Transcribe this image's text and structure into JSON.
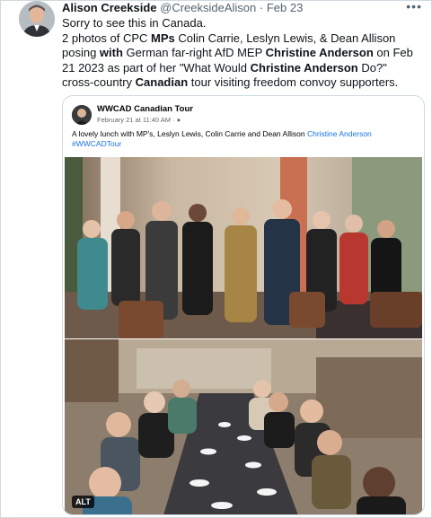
{
  "author": {
    "name": "Alison Creekside",
    "handle": "@CreeksideAlison",
    "separator": "·",
    "time": "Feb 23",
    "more_icon": "more-horizontal-icon"
  },
  "tweet": {
    "line1": "Sorry to see this in Canada.",
    "p1": "2 photos of CPC ",
    "b1": "MPs",
    "p2": " Colin Carrie, Leslyn Lewis, & Dean Allison posing ",
    "b2": "with",
    "p3": " German far-right AfD MEP ",
    "b3": "Christine Anderson",
    "p4": " on Feb 21 2023 as part of her \"What Would ",
    "b4": "Christine Anderson",
    "p5": " Do?\" cross-country ",
    "b5": "Canadian",
    "p6": " tour visiting freedom convoy supporters."
  },
  "card": {
    "page_name": "WWCAD Canadian Tour",
    "meta": "February 21 at 11:40 AM · ",
    "globe_icon": "globe-icon",
    "text": "A lovely lunch with MP's, Leslyn Lewis, Colin Carrie and Dean Allison ",
    "link1": "Christine Anderson",
    "hashtag": "#WWCADTour",
    "alt_badge": "ALT"
  },
  "colors": {
    "link": "#1b74e4",
    "muted": "#536471",
    "border": "#cfd9de"
  }
}
